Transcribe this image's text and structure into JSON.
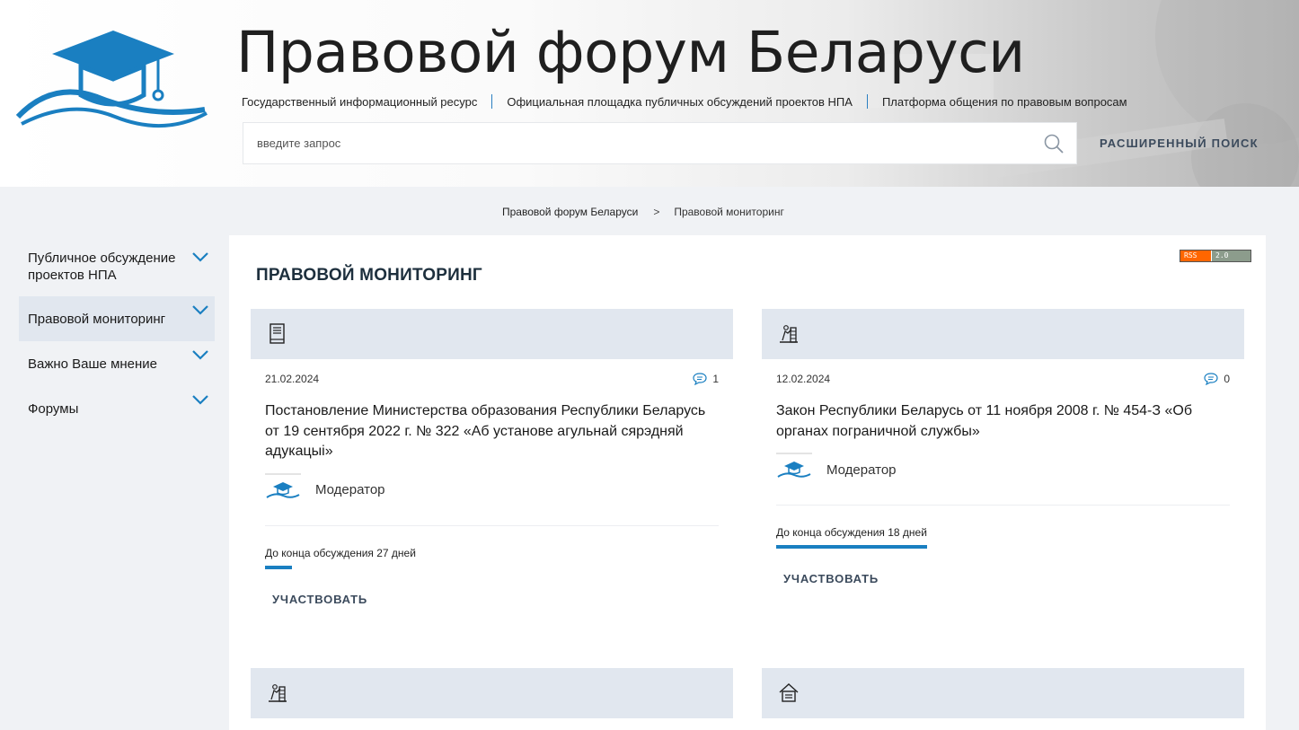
{
  "header": {
    "site_title": "Правовой форум Беларуси",
    "taglines": [
      "Государственный информационный ресурс",
      "Официальная площадка публичных обсуждений проектов НПА",
      "Платформа общения по правовым вопросам"
    ],
    "search": {
      "placeholder": "введите запрос",
      "value": ""
    },
    "advanced_search_label": "РАСШИРЕННЫЙ ПОИСК",
    "logo_color": "#1a7fc1"
  },
  "breadcrumb": {
    "root": "Правовой форум Беларуси",
    "separator": ">",
    "current": "Правовой мониторинг"
  },
  "sidebar": {
    "items": [
      {
        "label": "Публичное обсуждение проектов НПА",
        "active": false
      },
      {
        "label": "Правовой мониторинг",
        "active": true
      },
      {
        "label": "Важно Ваше мнение",
        "active": false
      },
      {
        "label": "Форумы",
        "active": false
      }
    ]
  },
  "main": {
    "rss_badge": {
      "left": "RSS",
      "right": "2.0"
    },
    "page_title": "ПРАВОВОЙ МОНИТОРИНГ",
    "cards": [
      {
        "icon": "book-icon",
        "date": "21.02.2024",
        "comments": "1",
        "title": "Постановление Министерства образования Республики Беларусь от 19 сентября 2022 г. № 322 «Аб установе агульнай сярэдняй адукацыі»",
        "author": "Модератор",
        "deadline": "До конца обсуждения 27 дней",
        "deadline_progress": 0.18,
        "participate_label": "УЧАСТВОВАТЬ"
      },
      {
        "icon": "border-guard-icon",
        "date": "12.02.2024",
        "comments": "0",
        "title": "Закон Республики Беларусь от 11 ноября 2008 г. № 454-З «Об органах пограничной службы»",
        "author": "Модератор",
        "deadline": "До конца обсуждения 18 дней",
        "deadline_progress": 1.0,
        "participate_label": "УЧАСТВОВАТЬ"
      },
      {
        "icon": "border-guard-icon"
      },
      {
        "icon": "house-icon"
      }
    ]
  },
  "colors": {
    "accent": "#1a7fc1",
    "card_band": "#e1e7ef",
    "page_bg": "#f0f2f5",
    "rss_orange": "#ff6600"
  }
}
